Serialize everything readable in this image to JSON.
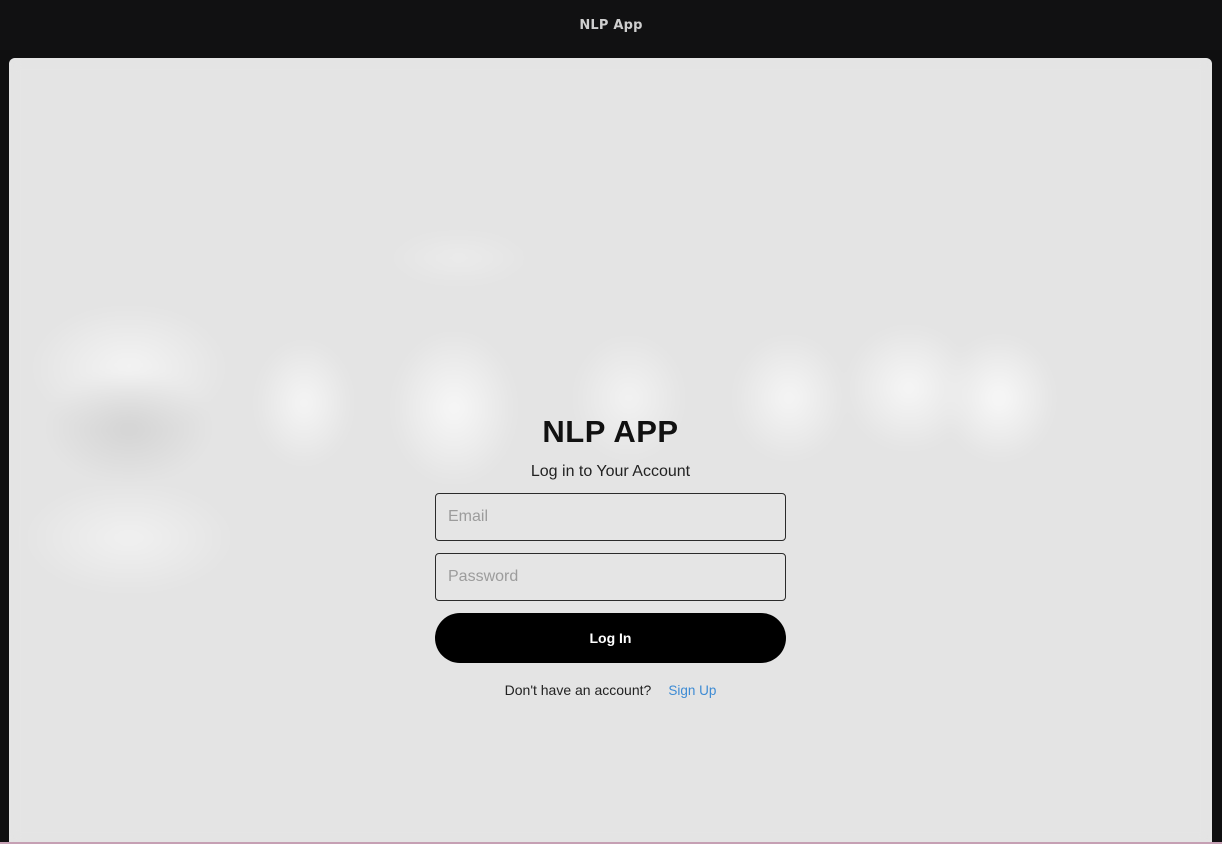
{
  "window": {
    "title": "NLP App"
  },
  "login": {
    "app_title": "NLP APP",
    "subtitle": "Log in to Your Account",
    "email_placeholder": "Email",
    "email_value": "",
    "password_placeholder": "Password",
    "password_value": "",
    "login_button": "Log In",
    "signup_prompt": "Don't have an account?",
    "signup_link": "Sign Up"
  },
  "colors": {
    "titlebar_bg": "#111112",
    "content_bg": "#e4e4e4",
    "button_bg": "#000000",
    "link": "#3d8bd4"
  }
}
